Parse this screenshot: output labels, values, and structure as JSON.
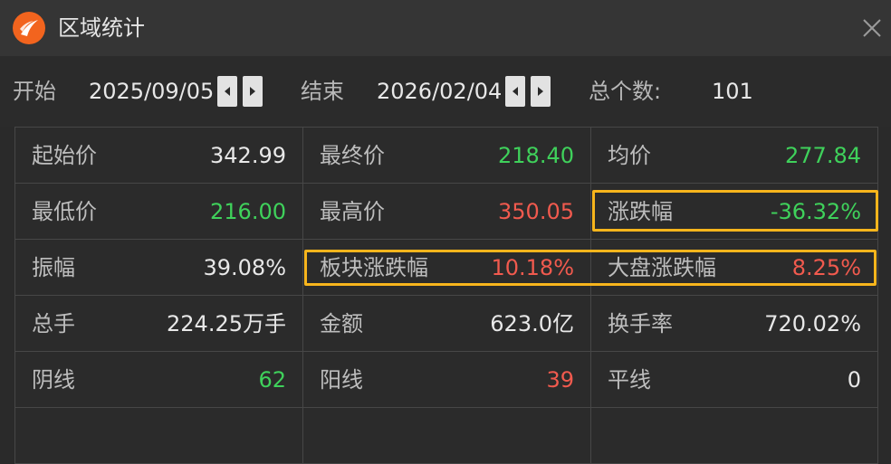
{
  "window": {
    "title": "区域统计"
  },
  "range": {
    "start_label": "开始",
    "start_date": "2025/09/05",
    "end_label": "结束",
    "end_date": "2026/02/04",
    "count_label": "总个数:",
    "count_value": "101"
  },
  "stats": {
    "row1": [
      {
        "label": "起始价",
        "value": "342.99"
      },
      {
        "label": "最终价",
        "value": "218.40"
      },
      {
        "label": "均价",
        "value": "277.84"
      }
    ],
    "row2": [
      {
        "label": "最低价",
        "value": "216.00"
      },
      {
        "label": "最高价",
        "value": "350.05"
      },
      {
        "label": "涨跌幅",
        "value": "-36.32%"
      }
    ],
    "row3": [
      {
        "label": "振幅",
        "value": "39.08%"
      },
      {
        "label": "板块涨跌幅",
        "value": "10.18%"
      },
      {
        "label": "大盘涨跌幅",
        "value": "8.25%"
      }
    ],
    "row4": [
      {
        "label": "总手",
        "value": "224.25万手"
      },
      {
        "label": "金额",
        "value": "623.0亿"
      },
      {
        "label": "换手率",
        "value": "720.02%"
      }
    ],
    "row5": [
      {
        "label": "阴线",
        "value": "62"
      },
      {
        "label": "阳线",
        "value": "39"
      },
      {
        "label": "平线",
        "value": "0"
      }
    ]
  },
  "colors": {
    "up": "#f15a4e",
    "down": "#3fd15b",
    "highlight": "#f7b51c",
    "logo": "#f2641e"
  }
}
